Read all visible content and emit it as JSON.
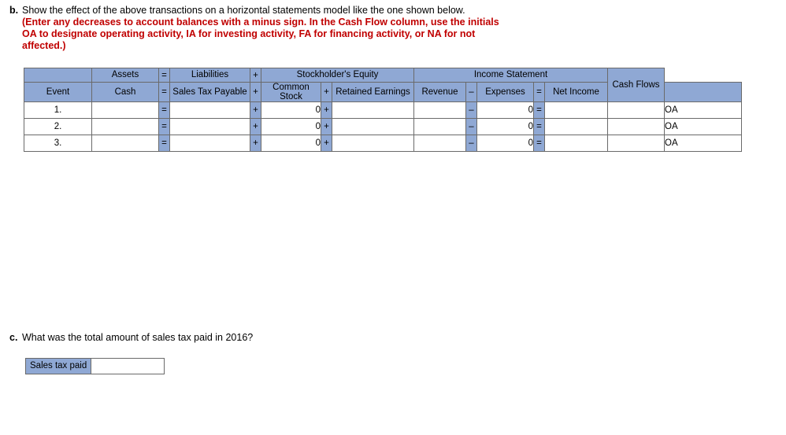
{
  "part_b": {
    "letter": "b.",
    "text": "Show the effect of the above transactions on a horizontal statements model like the one shown below.",
    "instruction": "(Enter any decreases to account balances with a minus sign. In the Cash Flow column, use the initials OA to designate operating activity, IA for investing activity, FA for financing activity, or NA for not affected.)"
  },
  "table": {
    "group_headers": {
      "assets": "Assets",
      "eq1": "=",
      "liabilities": "Liabilities",
      "plus1": "+",
      "stockholders_equity": "Stockholder's Equity",
      "income_statement": "Income Statement",
      "cash_flows": "Cash Flows"
    },
    "column_headers": {
      "event": "Event",
      "cash": "Cash",
      "eq1": "=",
      "sales_tax_payable": "Sales Tax Payable",
      "plus1": "+",
      "common_stock": "Common Stock",
      "plus2": "+",
      "retained_earnings": "Retained Earnings",
      "revenue": "Revenue",
      "minus": "–",
      "expenses": "Expenses",
      "eq2": "=",
      "net_income": "Net Income"
    },
    "rows": [
      {
        "event": "1.",
        "cash": "",
        "eq1": "=",
        "sales_tax_payable": "",
        "plus1": "+",
        "common_stock": "0",
        "plus2": "+",
        "retained_earnings": "",
        "revenue": "",
        "minus": "–",
        "expenses": "0",
        "eq2": "=",
        "net_income": "",
        "blank": "",
        "cash_flow": "OA"
      },
      {
        "event": "2.",
        "cash": "",
        "eq1": "=",
        "sales_tax_payable": "",
        "plus1": "+",
        "common_stock": "0",
        "plus2": "+",
        "retained_earnings": "",
        "revenue": "",
        "minus": "–",
        "expenses": "0",
        "eq2": "=",
        "net_income": "",
        "blank": "",
        "cash_flow": "OA"
      },
      {
        "event": "3.",
        "cash": "",
        "eq1": "=",
        "sales_tax_payable": "",
        "plus1": "+",
        "common_stock": "0",
        "plus2": "+",
        "retained_earnings": "",
        "revenue": "",
        "minus": "–",
        "expenses": "0",
        "eq2": "=",
        "net_income": "",
        "blank": "",
        "cash_flow": "OA"
      }
    ]
  },
  "part_c": {
    "letter": "c.",
    "text": "What was the total amount of sales tax paid in 2016?",
    "answer_label": "Sales tax paid",
    "answer_value": ""
  },
  "colors": {
    "header_blue": "#8fa8d4",
    "red_text": "#c00000",
    "border": "#6a6a6a"
  }
}
